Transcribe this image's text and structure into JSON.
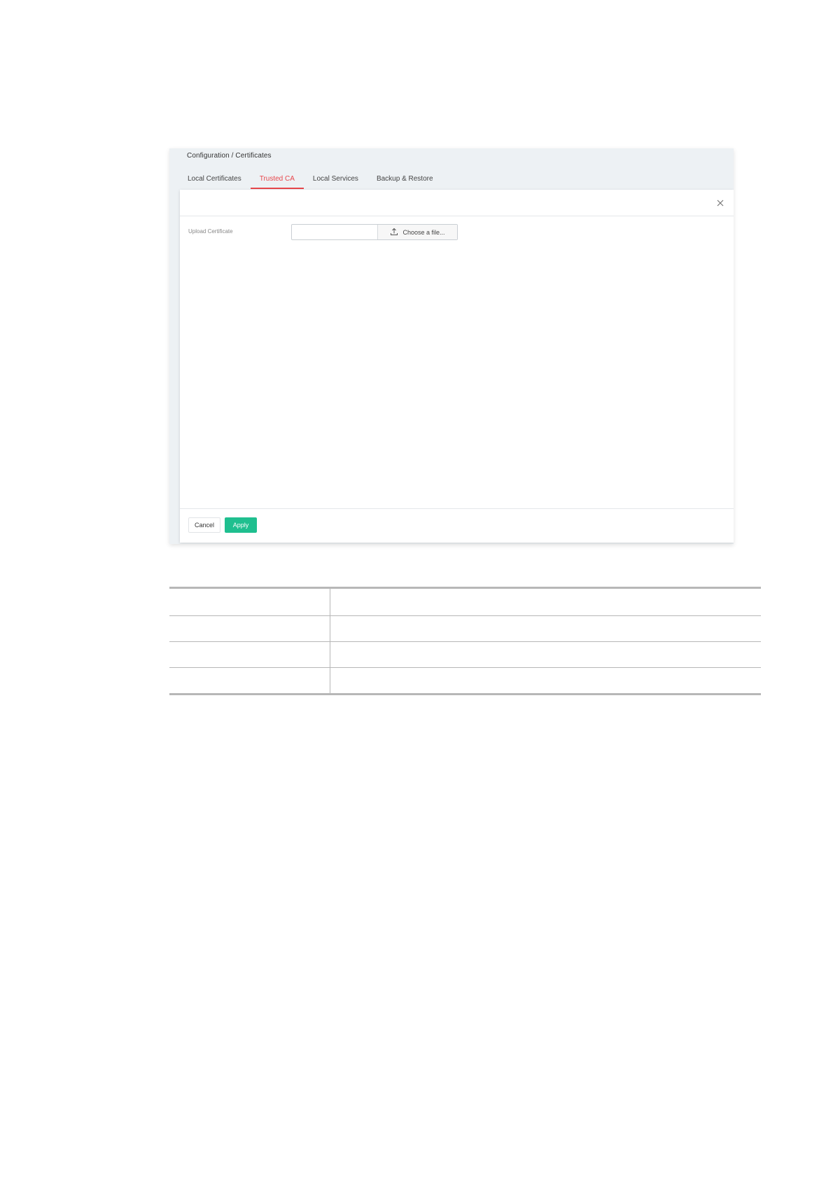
{
  "breadcrumb": "Configuration / Certificates",
  "tabs": [
    {
      "label": "Local Certificates",
      "active": false
    },
    {
      "label": "Trusted CA",
      "active": true
    },
    {
      "label": "Local Services",
      "active": false
    },
    {
      "label": "Backup & Restore",
      "active": false
    }
  ],
  "modal": {
    "upload_label": "Upload Certificate",
    "choose_label": "Choose a file...",
    "file_value": "",
    "cancel_label": "Cancel",
    "apply_label": "Apply"
  },
  "colors": {
    "active_tab": "#e8474c",
    "apply_button": "#1fbf8f"
  },
  "icons": {
    "close": "close-icon",
    "upload": "upload-icon"
  },
  "table": {
    "rows": [
      [
        "",
        ""
      ],
      [
        "",
        ""
      ],
      [
        "",
        ""
      ],
      [
        "",
        ""
      ]
    ]
  }
}
